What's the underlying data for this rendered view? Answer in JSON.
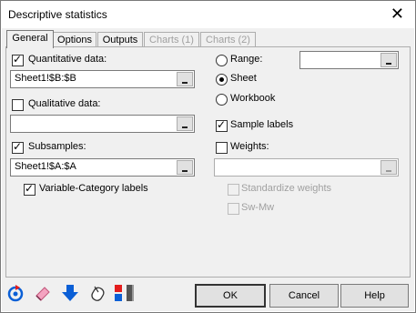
{
  "window": {
    "title": "Descriptive statistics"
  },
  "tabs": [
    {
      "label": "General",
      "active": true,
      "enabled": true
    },
    {
      "label": "Options",
      "active": false,
      "enabled": true
    },
    {
      "label": "Outputs",
      "active": false,
      "enabled": true
    },
    {
      "label": "Charts (1)",
      "active": false,
      "enabled": false
    },
    {
      "label": "Charts (2)",
      "active": false,
      "enabled": false
    }
  ],
  "general": {
    "quantitative": {
      "label": "Quantitative data:",
      "checked": true,
      "value": "Sheet1!$B:$B"
    },
    "qualitative": {
      "label": "Qualitative data:",
      "checked": false,
      "value": ""
    },
    "subsamples": {
      "label": "Subsamples:",
      "checked": true,
      "value": "Sheet1!$A:$A"
    },
    "variable_category": {
      "label": "Variable-Category labels",
      "checked": true
    },
    "range": {
      "label": "Range:",
      "value": ""
    },
    "sheet": {
      "label": "Sheet",
      "selected": true
    },
    "workbook": {
      "label": "Workbook"
    },
    "sample_labels": {
      "label": "Sample labels",
      "checked": true
    },
    "weights": {
      "label": "Weights:",
      "checked": false,
      "value": ""
    },
    "standardize": {
      "label": "Standardize weights",
      "enabled": false
    },
    "swmw": {
      "label": "Sw-Mw",
      "enabled": false
    }
  },
  "toolbar": {
    "icons": [
      "reset-icon",
      "eraser-icon",
      "down-arrow-icon",
      "mouse-icon",
      "color-squares-icon"
    ]
  },
  "buttons": {
    "ok": "OK",
    "cancel": "Cancel",
    "help": "Help"
  },
  "colors": {
    "accent_blue": "#0b5fd6",
    "accent_red": "#e31d1d",
    "disabled_text": "#a0a0a0"
  }
}
